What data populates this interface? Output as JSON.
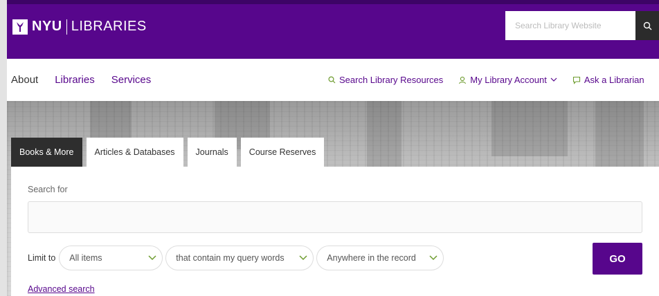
{
  "header": {
    "logo_nyu": "NYU",
    "logo_libraries": "LIBRARIES",
    "site_search_placeholder": "Search Library Website",
    "brand_color": "#57068c"
  },
  "nav": {
    "left": [
      "About",
      "Libraries",
      "Services"
    ],
    "search_resources": "Search Library Resources",
    "my_account": "My Library Account",
    "ask_librarian": "Ask a Librarian"
  },
  "tabs": [
    {
      "label": "Books & More",
      "active": true
    },
    {
      "label": "Articles & Databases",
      "active": false
    },
    {
      "label": "Journals",
      "active": false
    },
    {
      "label": "Course Reserves",
      "active": false
    }
  ],
  "search": {
    "label": "Search for",
    "value": "",
    "limit_label": "Limit to",
    "scope": "All items",
    "match": "that contain my query words",
    "field": "Anywhere in the record",
    "go_label": "GO",
    "advanced_link": "Advanced search"
  },
  "icons": {
    "chevron_color": "#6e9c2f"
  }
}
